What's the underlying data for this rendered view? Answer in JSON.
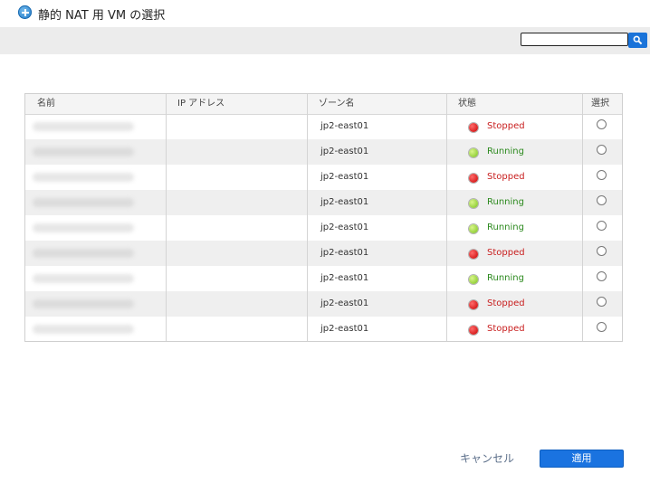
{
  "dialog": {
    "title": "静的 NAT 用 VM の選択"
  },
  "search": {
    "value": "",
    "placeholder": ""
  },
  "table": {
    "columns": [
      "名前",
      "IP アドレス",
      "ゾーン名",
      "状態",
      "選択"
    ],
    "rows": [
      {
        "name": "",
        "ip": "",
        "zone": "jp2-east01",
        "status": "Stopped",
        "status_color": "#c81e1e",
        "selected": false
      },
      {
        "name": "",
        "ip": "",
        "zone": "jp2-east01",
        "status": "Running",
        "status_color": "#2d8a1f",
        "selected": false
      },
      {
        "name": "",
        "ip": "",
        "zone": "jp2-east01",
        "status": "Stopped",
        "status_color": "#c81e1e",
        "selected": false
      },
      {
        "name": "",
        "ip": "",
        "zone": "jp2-east01",
        "status": "Running",
        "status_color": "#2d8a1f",
        "selected": false
      },
      {
        "name": "",
        "ip": "",
        "zone": "jp2-east01",
        "status": "Running",
        "status_color": "#2d8a1f",
        "selected": false
      },
      {
        "name": "",
        "ip": "",
        "zone": "jp2-east01",
        "status": "Stopped",
        "status_color": "#c81e1e",
        "selected": false
      },
      {
        "name": "",
        "ip": "",
        "zone": "jp2-east01",
        "status": "Running",
        "status_color": "#2d8a1f",
        "selected": false
      },
      {
        "name": "",
        "ip": "",
        "zone": "jp2-east01",
        "status": "Stopped",
        "status_color": "#c81e1e",
        "selected": false
      },
      {
        "name": "",
        "ip": "",
        "zone": "jp2-east01",
        "status": "Stopped",
        "status_color": "#c81e1e",
        "selected": false
      }
    ]
  },
  "footer": {
    "cancel_label": "キャンセル",
    "apply_label": "適用"
  },
  "colors": {
    "accent": "#1a73e0",
    "toolbar_bg": "#ececec"
  },
  "icons": {
    "title": "add-circle-icon",
    "search": "search-icon"
  }
}
